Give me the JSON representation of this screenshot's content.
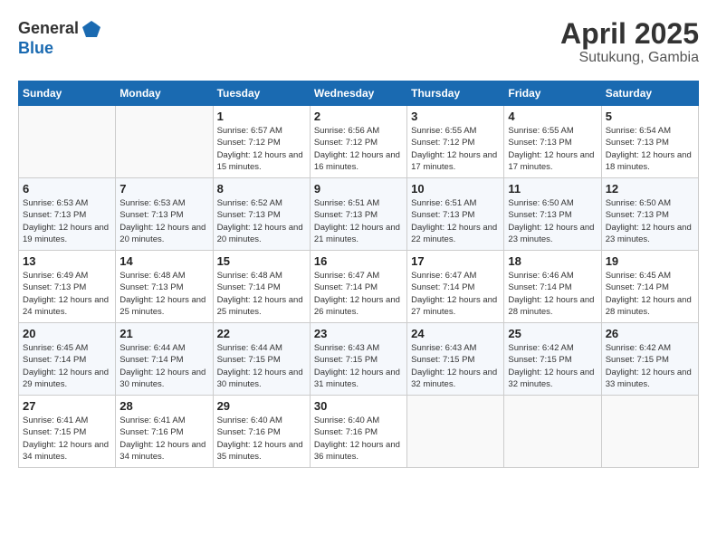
{
  "logo": {
    "text_general": "General",
    "text_blue": "Blue"
  },
  "header": {
    "month": "April 2025",
    "location": "Sutukung, Gambia"
  },
  "days_of_week": [
    "Sunday",
    "Monday",
    "Tuesday",
    "Wednesday",
    "Thursday",
    "Friday",
    "Saturday"
  ],
  "weeks": [
    [
      {
        "day": "",
        "sunrise": "",
        "sunset": "",
        "daylight": ""
      },
      {
        "day": "",
        "sunrise": "",
        "sunset": "",
        "daylight": ""
      },
      {
        "day": "1",
        "sunrise": "Sunrise: 6:57 AM",
        "sunset": "Sunset: 7:12 PM",
        "daylight": "Daylight: 12 hours and 15 minutes."
      },
      {
        "day": "2",
        "sunrise": "Sunrise: 6:56 AM",
        "sunset": "Sunset: 7:12 PM",
        "daylight": "Daylight: 12 hours and 16 minutes."
      },
      {
        "day": "3",
        "sunrise": "Sunrise: 6:55 AM",
        "sunset": "Sunset: 7:12 PM",
        "daylight": "Daylight: 12 hours and 17 minutes."
      },
      {
        "day": "4",
        "sunrise": "Sunrise: 6:55 AM",
        "sunset": "Sunset: 7:13 PM",
        "daylight": "Daylight: 12 hours and 17 minutes."
      },
      {
        "day": "5",
        "sunrise": "Sunrise: 6:54 AM",
        "sunset": "Sunset: 7:13 PM",
        "daylight": "Daylight: 12 hours and 18 minutes."
      }
    ],
    [
      {
        "day": "6",
        "sunrise": "Sunrise: 6:53 AM",
        "sunset": "Sunset: 7:13 PM",
        "daylight": "Daylight: 12 hours and 19 minutes."
      },
      {
        "day": "7",
        "sunrise": "Sunrise: 6:53 AM",
        "sunset": "Sunset: 7:13 PM",
        "daylight": "Daylight: 12 hours and 20 minutes."
      },
      {
        "day": "8",
        "sunrise": "Sunrise: 6:52 AM",
        "sunset": "Sunset: 7:13 PM",
        "daylight": "Daylight: 12 hours and 20 minutes."
      },
      {
        "day": "9",
        "sunrise": "Sunrise: 6:51 AM",
        "sunset": "Sunset: 7:13 PM",
        "daylight": "Daylight: 12 hours and 21 minutes."
      },
      {
        "day": "10",
        "sunrise": "Sunrise: 6:51 AM",
        "sunset": "Sunset: 7:13 PM",
        "daylight": "Daylight: 12 hours and 22 minutes."
      },
      {
        "day": "11",
        "sunrise": "Sunrise: 6:50 AM",
        "sunset": "Sunset: 7:13 PM",
        "daylight": "Daylight: 12 hours and 23 minutes."
      },
      {
        "day": "12",
        "sunrise": "Sunrise: 6:50 AM",
        "sunset": "Sunset: 7:13 PM",
        "daylight": "Daylight: 12 hours and 23 minutes."
      }
    ],
    [
      {
        "day": "13",
        "sunrise": "Sunrise: 6:49 AM",
        "sunset": "Sunset: 7:13 PM",
        "daylight": "Daylight: 12 hours and 24 minutes."
      },
      {
        "day": "14",
        "sunrise": "Sunrise: 6:48 AM",
        "sunset": "Sunset: 7:13 PM",
        "daylight": "Daylight: 12 hours and 25 minutes."
      },
      {
        "day": "15",
        "sunrise": "Sunrise: 6:48 AM",
        "sunset": "Sunset: 7:14 PM",
        "daylight": "Daylight: 12 hours and 25 minutes."
      },
      {
        "day": "16",
        "sunrise": "Sunrise: 6:47 AM",
        "sunset": "Sunset: 7:14 PM",
        "daylight": "Daylight: 12 hours and 26 minutes."
      },
      {
        "day": "17",
        "sunrise": "Sunrise: 6:47 AM",
        "sunset": "Sunset: 7:14 PM",
        "daylight": "Daylight: 12 hours and 27 minutes."
      },
      {
        "day": "18",
        "sunrise": "Sunrise: 6:46 AM",
        "sunset": "Sunset: 7:14 PM",
        "daylight": "Daylight: 12 hours and 28 minutes."
      },
      {
        "day": "19",
        "sunrise": "Sunrise: 6:45 AM",
        "sunset": "Sunset: 7:14 PM",
        "daylight": "Daylight: 12 hours and 28 minutes."
      }
    ],
    [
      {
        "day": "20",
        "sunrise": "Sunrise: 6:45 AM",
        "sunset": "Sunset: 7:14 PM",
        "daylight": "Daylight: 12 hours and 29 minutes."
      },
      {
        "day": "21",
        "sunrise": "Sunrise: 6:44 AM",
        "sunset": "Sunset: 7:14 PM",
        "daylight": "Daylight: 12 hours and 30 minutes."
      },
      {
        "day": "22",
        "sunrise": "Sunrise: 6:44 AM",
        "sunset": "Sunset: 7:15 PM",
        "daylight": "Daylight: 12 hours and 30 minutes."
      },
      {
        "day": "23",
        "sunrise": "Sunrise: 6:43 AM",
        "sunset": "Sunset: 7:15 PM",
        "daylight": "Daylight: 12 hours and 31 minutes."
      },
      {
        "day": "24",
        "sunrise": "Sunrise: 6:43 AM",
        "sunset": "Sunset: 7:15 PM",
        "daylight": "Daylight: 12 hours and 32 minutes."
      },
      {
        "day": "25",
        "sunrise": "Sunrise: 6:42 AM",
        "sunset": "Sunset: 7:15 PM",
        "daylight": "Daylight: 12 hours and 32 minutes."
      },
      {
        "day": "26",
        "sunrise": "Sunrise: 6:42 AM",
        "sunset": "Sunset: 7:15 PM",
        "daylight": "Daylight: 12 hours and 33 minutes."
      }
    ],
    [
      {
        "day": "27",
        "sunrise": "Sunrise: 6:41 AM",
        "sunset": "Sunset: 7:15 PM",
        "daylight": "Daylight: 12 hours and 34 minutes."
      },
      {
        "day": "28",
        "sunrise": "Sunrise: 6:41 AM",
        "sunset": "Sunset: 7:16 PM",
        "daylight": "Daylight: 12 hours and 34 minutes."
      },
      {
        "day": "29",
        "sunrise": "Sunrise: 6:40 AM",
        "sunset": "Sunset: 7:16 PM",
        "daylight": "Daylight: 12 hours and 35 minutes."
      },
      {
        "day": "30",
        "sunrise": "Sunrise: 6:40 AM",
        "sunset": "Sunset: 7:16 PM",
        "daylight": "Daylight: 12 hours and 36 minutes."
      },
      {
        "day": "",
        "sunrise": "",
        "sunset": "",
        "daylight": ""
      },
      {
        "day": "",
        "sunrise": "",
        "sunset": "",
        "daylight": ""
      },
      {
        "day": "",
        "sunrise": "",
        "sunset": "",
        "daylight": ""
      }
    ]
  ]
}
